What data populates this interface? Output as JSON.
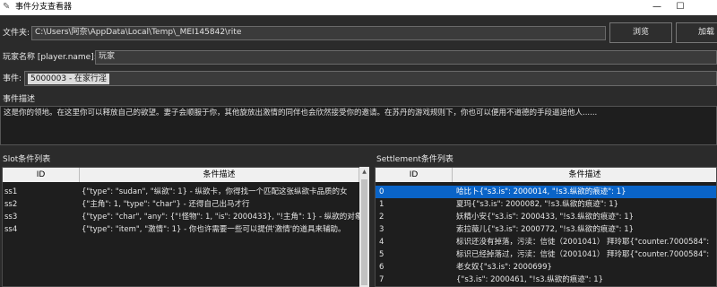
{
  "window": {
    "title": "事件分支查看器",
    "minimize": "—",
    "maximize": "☐"
  },
  "file_row": {
    "label": "文件夹:",
    "path": "C:\\Users\\阿奈\\AppData\\Local\\Temp\\_MEI145842\\rite",
    "browse": "浏览",
    "load": "加载"
  },
  "player_row": {
    "label": "玩家名称 [player.name]:",
    "value": "玩家"
  },
  "event_row": {
    "label": "事件:",
    "selected": "5000003 - 在家行淫"
  },
  "description": {
    "label": "事件描述",
    "text": "这是你的领地。在这里你可以释放自己的欲望。妻子会顺服于你，其他旋放出激情的同伴也会欣然接受你的邀请。在苏丹的游戏规则下，你也可以便用不道德的手段逼迫他人......"
  },
  "slot_table": {
    "label": "Slot条件列表",
    "columns": [
      "ID",
      "条件描述"
    ],
    "rows": [
      {
        "id": "ss1",
        "desc": "{\"type\": \"sudan\", \"纵欲\": 1} - 纵欲卡，你得找一个匹配这张纵欲卡品质的女"
      },
      {
        "id": "ss2",
        "desc": "{\"主角\": 1, \"type\": \"char\"} - 还得自己出马才行"
      },
      {
        "id": "ss3",
        "desc": "{\"type\": \"char\", \"any\": {\"!怪物\": 1, \"is\": 2000433}, \"!主角\": 1} - 纵欲的对象"
      },
      {
        "id": "ss4",
        "desc": "{\"type\": \"item\", \"激情\": 1} - 你也许需要一些可以提供'激情'的道具来辅助。"
      }
    ]
  },
  "settlement_table": {
    "label": "Settlement条件列表",
    "columns": [
      "ID",
      "条件描述"
    ],
    "rows": [
      {
        "id": "0",
        "desc": "哈比卜{\"s3.is\": 2000014, \"!s3.纵欲的痕迹\": 1}",
        "selected": true
      },
      {
        "id": "1",
        "desc": "夏玛{\"s3.is\": 2000082, \"!s3.纵欲的痕迹\": 1}",
        "selected": false
      },
      {
        "id": "2",
        "desc": "妖精小安{\"s3.is\": 2000433, \"!s3.纵欲的痕迹\": 1}",
        "selected": false
      },
      {
        "id": "3",
        "desc": "索拉薇儿{\"s3.is\": 2000772, \"!s3.纵欲的痕迹\": 1}",
        "selected": false
      },
      {
        "id": "4",
        "desc": "标识还没有掉落，污渎：信徒（2001041） 拜玲耶{\"counter.7000584\":",
        "selected": false
      },
      {
        "id": "5",
        "desc": "标识已经掉落过，污渎：信徒（2001041） 拜玲耶{\"counter.7000584\":",
        "selected": false
      },
      {
        "id": "6",
        "desc": "老女奴{\"s3.is\": 2000699}",
        "selected": false
      },
      {
        "id": "7",
        "desc": "{\"s3.is\": 2000461, \"!s3.纵欲的痕迹\": 1}",
        "selected": false
      }
    ]
  },
  "icons": {
    "app": "feather-icon",
    "scroll_up": "▲",
    "scroll_down": "▼"
  },
  "colors": {
    "background": "#2b2b2b",
    "selection": "#0a64c8",
    "header_bg": "#f0f0f0"
  }
}
